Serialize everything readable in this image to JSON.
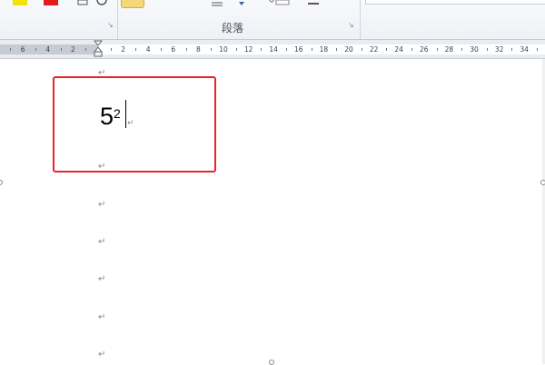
{
  "ribbon": {
    "paragraph_group_label": "段落",
    "launcher_icon": "dialog-launcher-icon",
    "swatch_colors": [
      "#f4e200",
      "#e41b1b"
    ],
    "accent": "#f5d77b"
  },
  "ruler": {
    "labels_left": [
      "6",
      "4",
      "2"
    ],
    "labels_right": [
      "2",
      "4",
      "6",
      "8",
      "10",
      "12",
      "14",
      "16",
      "18",
      "20",
      "22",
      "24",
      "26",
      "28",
      "30",
      "32",
      "34"
    ]
  },
  "document": {
    "base": "5",
    "exponent": "2",
    "paragraph_mark": "↵",
    "highlight_color": "#e8232a"
  }
}
